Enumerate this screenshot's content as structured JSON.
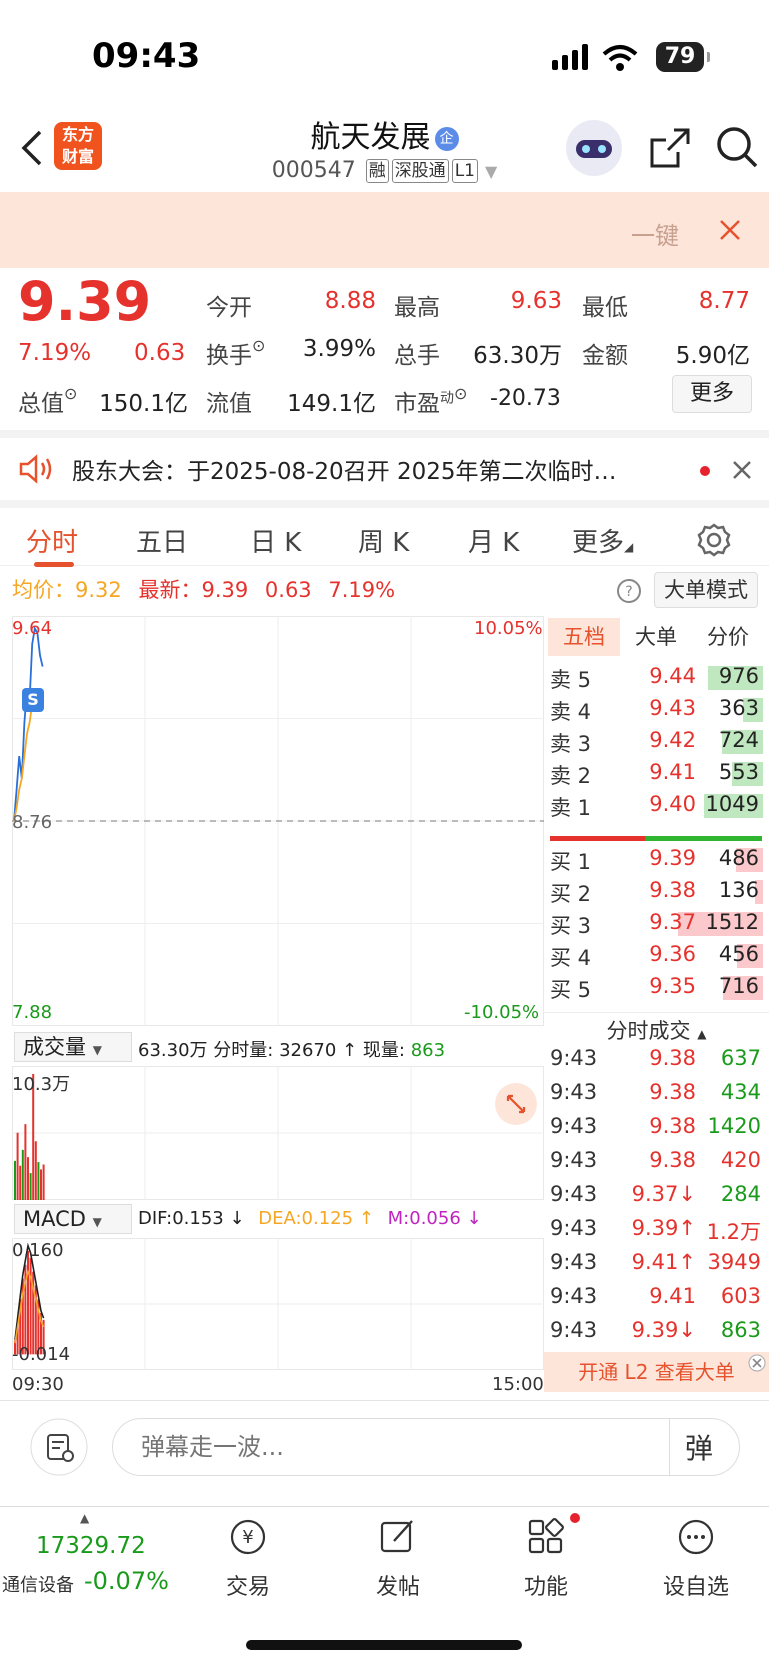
{
  "status_bar": {
    "time": "09:43",
    "battery": "79"
  },
  "header": {
    "logo_text_1": "东方",
    "logo_text_2": "财富",
    "stock_name": "航天发展",
    "stock_badge": "企",
    "stock_code": "000547",
    "tags": [
      "融",
      "深股通",
      "L1"
    ]
  },
  "promo": {
    "text": "一键"
  },
  "quote": {
    "price": "9.39",
    "change_pct": "7.19%",
    "change": "0.63",
    "open_label": "今开",
    "open": "8.88",
    "high_label": "最高",
    "high": "9.63",
    "low_label": "最低",
    "low": "8.77",
    "turnover_label": "换手",
    "turnover": "3.99%",
    "volume_label": "总手",
    "volume": "63.30万",
    "amount_label": "金额",
    "amount": "5.90亿",
    "mcap_label": "总值",
    "mcap": "150.1亿",
    "float_label": "流值",
    "float": "149.1亿",
    "pe_label": "市盈",
    "pe_sup": "动",
    "pe": "-20.73",
    "more_label": "更多"
  },
  "notice": {
    "text": "股东大会：于2025-08-20召开 2025年第二次临时…"
  },
  "tabs": [
    "分时",
    "五日",
    "日 K",
    "周 K",
    "月 K",
    "更多"
  ],
  "chart_header": {
    "avg_label": "均价：",
    "avg": "9.32",
    "latest_label": "最新：",
    "latest": "9.39",
    "latest_change": "0.63",
    "latest_pct": "7.19%",
    "mode_btn": "大单模式"
  },
  "chart_data": [
    {
      "type": "line",
      "title": "",
      "series": [
        {
          "values": [
            8.76,
            8.9,
            9.05,
            8.95,
            9.2,
            9.35,
            9.3,
            9.55,
            9.62,
            9.6,
            9.5,
            9.45
          ]
        },
        {
          "values": [
            8.76,
            8.82,
            8.9,
            8.95,
            9.05,
            9.15,
            9.2,
            9.28,
            9.32,
            9.33,
            9.32,
            9.32
          ]
        }
      ],
      "ylim": [
        7.88,
        9.64
      ],
      "y_tick_left_top": "9.64",
      "y_tick_left_mid": "8.76",
      "y_tick_left_bottom": "7.88",
      "y_tick_right_top": "10.05%",
      "y_tick_right_bottom": "-10.05%",
      "grid": true
    },
    {
      "type": "bar",
      "title": "成交量",
      "summary": "63.30万",
      "minute_vol_label": "分时量:",
      "minute_vol": "32670 ↑",
      "current_vol_label": "现量:",
      "current_vol": "863",
      "y_tick_top": "10.3万",
      "values": [
        3.2,
        5.5,
        2.8,
        4.1,
        6.2,
        3.5,
        2.2,
        10.3,
        4.8,
        3.1,
        2.5,
        2.9
      ],
      "ylim": [
        0,
        10.3
      ]
    },
    {
      "type": "bar",
      "title": "MACD",
      "dif_label": "DIF:0.153 ↓",
      "dea_label": "DEA:0.125 ↑",
      "m_label": "M:0.056 ↓",
      "y_tick_top": "0.160",
      "y_tick_bottom": "-0.014",
      "values": [
        0.02,
        0.05,
        0.08,
        0.11,
        0.13,
        0.15,
        0.14,
        0.12,
        0.1,
        0.08,
        0.06,
        0.05
      ],
      "ylim": [
        -0.014,
        0.16
      ],
      "x_tick_start": "09:30",
      "x_tick_end": "15:00"
    }
  ],
  "order_book": {
    "tabs": [
      "五档",
      "大单",
      "分价"
    ],
    "asks": [
      {
        "label": "卖 5",
        "price": "9.44",
        "vol": "976"
      },
      {
        "label": "卖 4",
        "price": "9.43",
        "vol": "363"
      },
      {
        "label": "卖 3",
        "price": "9.42",
        "vol": "724"
      },
      {
        "label": "卖 2",
        "price": "9.41",
        "vol": "553"
      },
      {
        "label": "卖 1",
        "price": "9.40",
        "vol": "1049"
      }
    ],
    "bids": [
      {
        "label": "买 1",
        "price": "9.39",
        "vol": "486"
      },
      {
        "label": "买 2",
        "price": "9.38",
        "vol": "136"
      },
      {
        "label": "买 3",
        "price": "9.37",
        "vol": "1512"
      },
      {
        "label": "买 4",
        "price": "9.36",
        "vol": "456"
      },
      {
        "label": "买 5",
        "price": "9.35",
        "vol": "716"
      }
    ]
  },
  "trades": {
    "title": "分时成交",
    "rows": [
      {
        "time": "9:43",
        "price": "9.38",
        "vol": "637",
        "dir": "green"
      },
      {
        "time": "9:43",
        "price": "9.38",
        "vol": "434",
        "dir": "green"
      },
      {
        "time": "9:43",
        "price": "9.38",
        "vol": "1420",
        "dir": "green"
      },
      {
        "time": "9:43",
        "price": "9.38",
        "vol": "420",
        "dir": "red"
      },
      {
        "time": "9:43",
        "price": "9.37↓",
        "vol": "284",
        "dir": "green"
      },
      {
        "time": "9:43",
        "price": "9.39↑",
        "vol": "1.2万",
        "dir": "red"
      },
      {
        "time": "9:43",
        "price": "9.41↑",
        "vol": "3949",
        "dir": "red"
      },
      {
        "time": "9:43",
        "price": "9.41",
        "vol": "603",
        "dir": "red"
      },
      {
        "time": "9:43",
        "price": "9.39↓",
        "vol": "863",
        "dir": "green"
      }
    ],
    "l2_banner": "开通 L2 查看大单"
  },
  "danmu": {
    "placeholder": "弹幕走一波...",
    "button": "弹"
  },
  "bottom_nav": {
    "index_value": "17329.72",
    "index_name": "通信设备",
    "index_change": "-0.07%",
    "items": [
      "交易",
      "发帖",
      "功能",
      "设自选"
    ]
  }
}
